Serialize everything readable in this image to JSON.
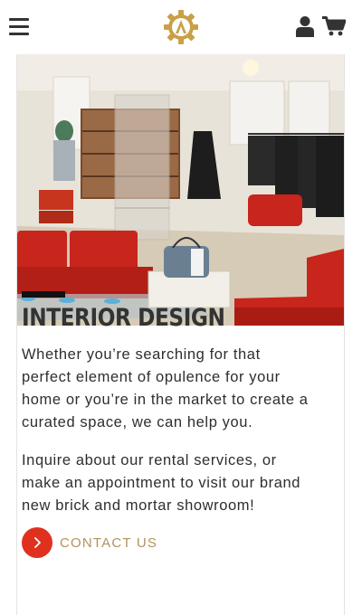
{
  "header": {
    "menu_icon": "hamburger-menu-icon",
    "logo_icon": "gear-a-logo-icon",
    "user_icon": "user-account-icon",
    "cart_icon": "shopping-cart-icon"
  },
  "hero": {
    "description_icon": "showroom-photo",
    "accent_color": "#c8251c"
  },
  "article": {
    "title": "INTERIOR DESIGN",
    "paragraph_1": "Whether you’re searching for that perfect element of opulence for your home or you’re in the market to create a curated space, we can help you.",
    "paragraph_2": "Inquire about our rental services, or make an appointment to visit our brand new brick and mortar showroom!",
    "cta_label": "CONTACT US",
    "cta_icon": "chevron-right-icon"
  },
  "colors": {
    "cta_circle": "#e0311e",
    "cta_text": "#b3925c",
    "logo_gold": "#c9a047"
  }
}
